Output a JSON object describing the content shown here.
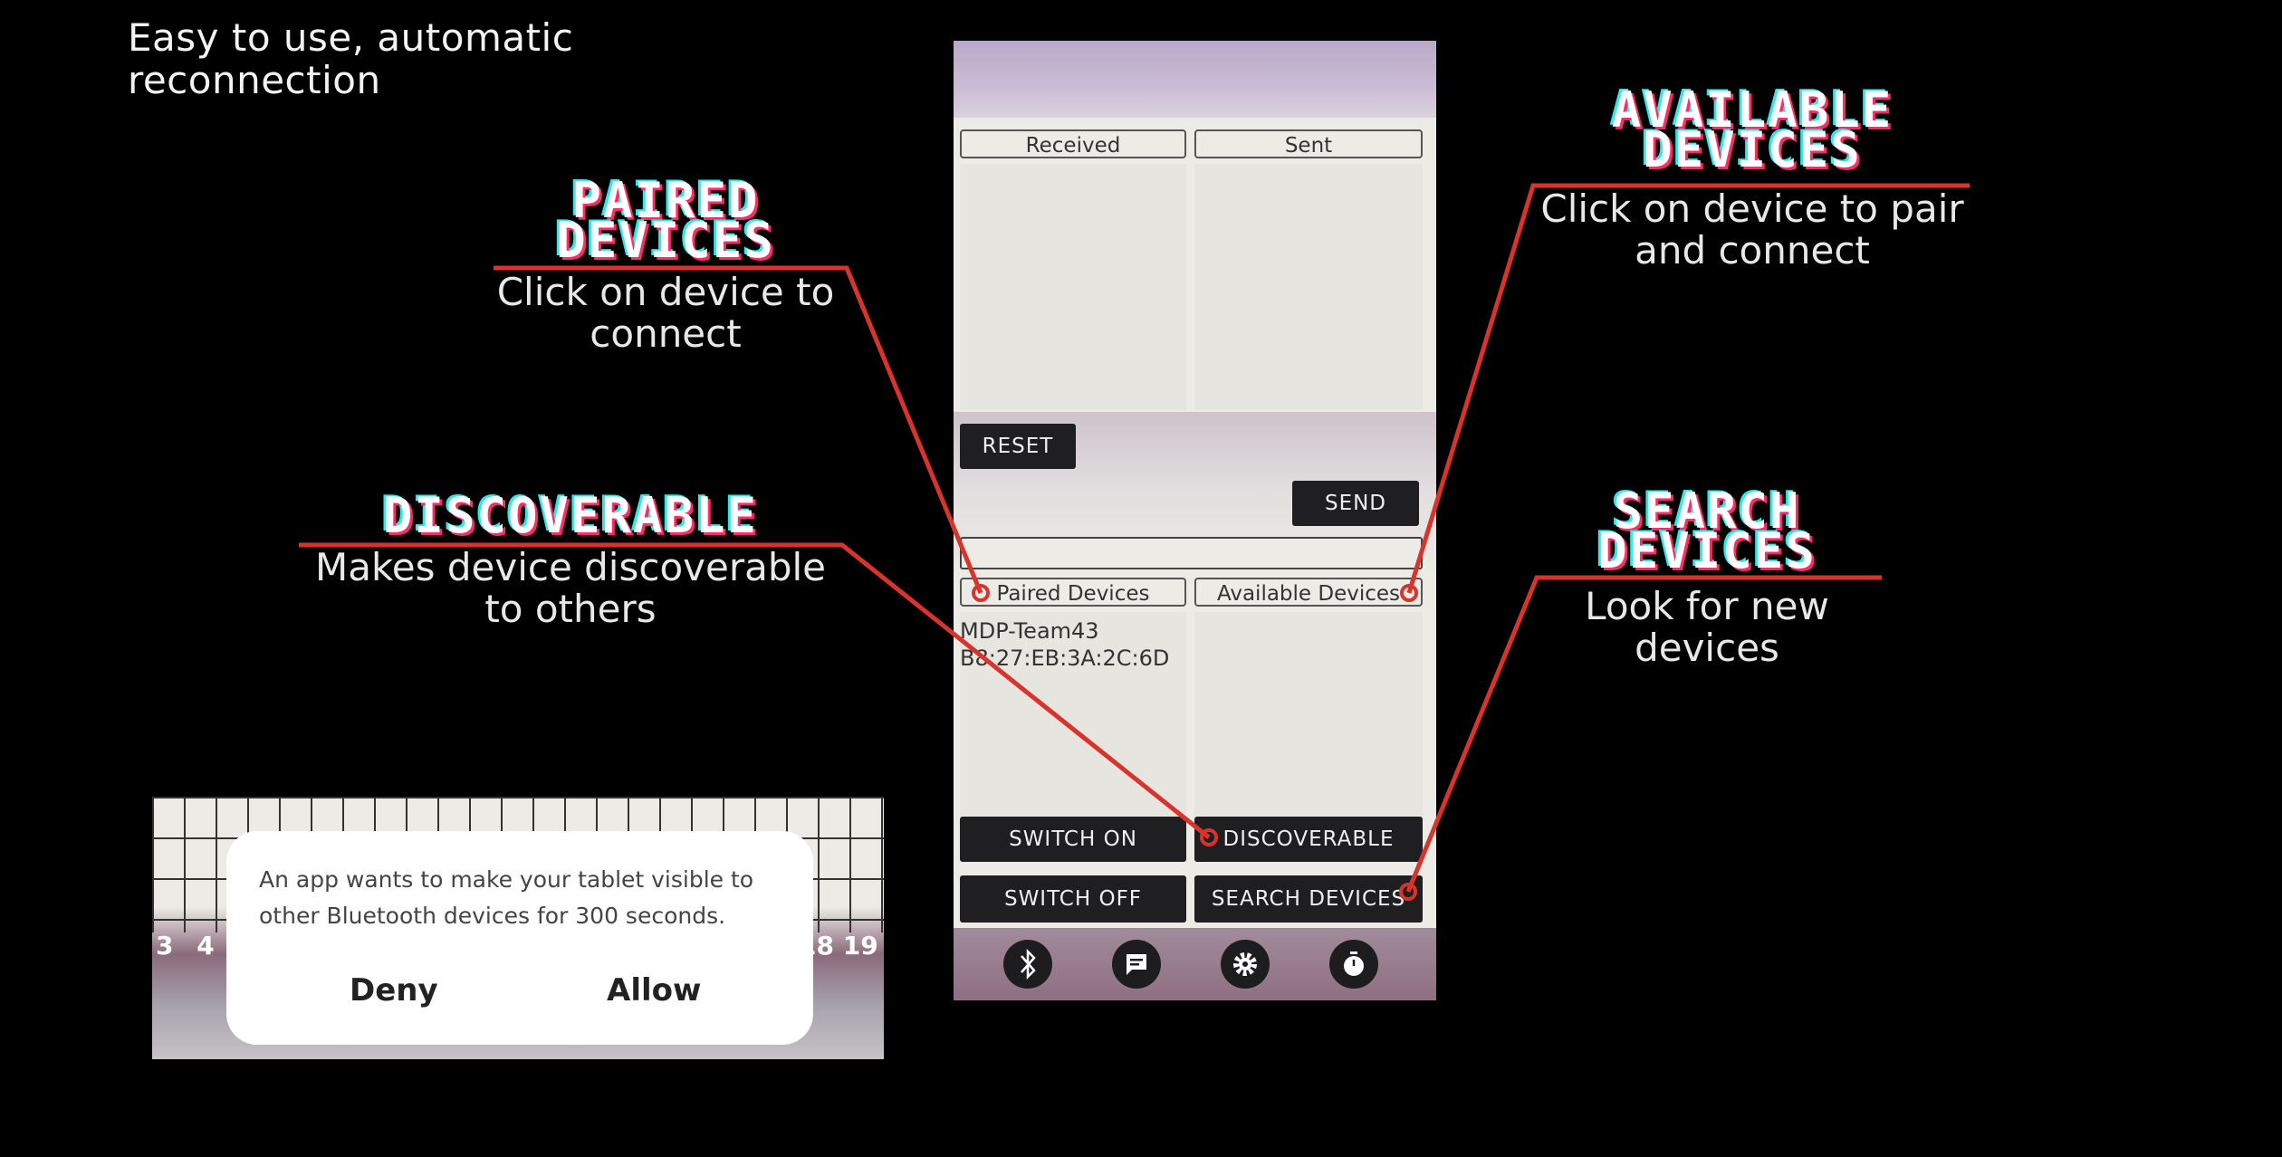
{
  "headline": "Easy to use, automatic reconnection",
  "callouts": {
    "paired": {
      "title_line1": "PAIRED",
      "title_line2": "DEVICES",
      "desc_line1": "Click on device to",
      "desc_line2": "connect"
    },
    "discoverable": {
      "title": "DISCOVERABLE",
      "desc_line1": "Makes device discoverable",
      "desc_line2": "to others"
    },
    "available": {
      "title_line1": "AVAILABLE",
      "title_line2": "DEVICES",
      "desc_line1": "Click on device to pair",
      "desc_line2": "and connect"
    },
    "search": {
      "title_line1": "SEARCH",
      "title_line2": "DEVICES",
      "desc_line1": "Look for new",
      "desc_line2": "devices"
    }
  },
  "phone": {
    "received_label": "Received",
    "sent_label": "Sent",
    "reset_label": "RESET",
    "send_label": "SEND",
    "paired_devices_label": "Paired Devices",
    "available_devices_label": "Available Devices",
    "paired_device": {
      "name": "MDP-Team43",
      "address": "B8:27:EB:3A:2C:6D"
    },
    "switch_on_label": "SWITCH ON",
    "discoverable_label": "DISCOVERABLE",
    "switch_off_label": "SWITCH OFF",
    "search_devices_label": "SEARCH DEVICES",
    "nav_icons": [
      "bluetooth-icon",
      "chat-icon",
      "gear-icon",
      "timer-icon"
    ]
  },
  "dialog": {
    "message": "An app wants to make your tablet visible to other Bluetooth devices for 300 seconds.",
    "deny_label": "Deny",
    "allow_label": "Allow",
    "grid_numbers_left": "3 4",
    "grid_numbers_right": "18 19"
  },
  "colors": {
    "accent_line": "#d9342b",
    "title_pink": "#ff2a6d",
    "title_cyan": "#35e8e8"
  }
}
